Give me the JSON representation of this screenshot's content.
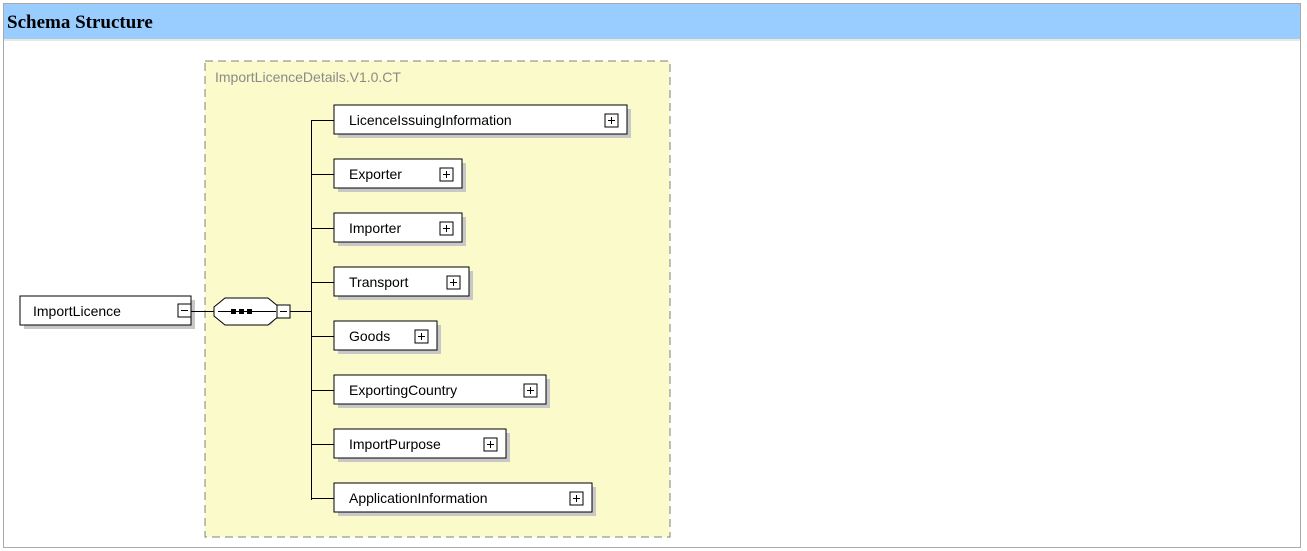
{
  "header": {
    "title": "Schema Structure"
  },
  "diagram": {
    "complex_type": "ImportLicenceDetails.V1.0.CT",
    "root": "ImportLicence",
    "compositor": "sequence",
    "children": [
      {
        "label": "LicenceIssuingInformation"
      },
      {
        "label": "Exporter"
      },
      {
        "label": "Importer"
      },
      {
        "label": "Transport"
      },
      {
        "label": "Goods"
      },
      {
        "label": "ExportingCountry"
      },
      {
        "label": "ImportPurpose"
      },
      {
        "label": "ApplicationInformation"
      }
    ],
    "colors": {
      "type_fill": "#fafacb",
      "type_border": "#808080",
      "shadow": "#c8c8c8",
      "header_bg": "#99ccff"
    }
  }
}
